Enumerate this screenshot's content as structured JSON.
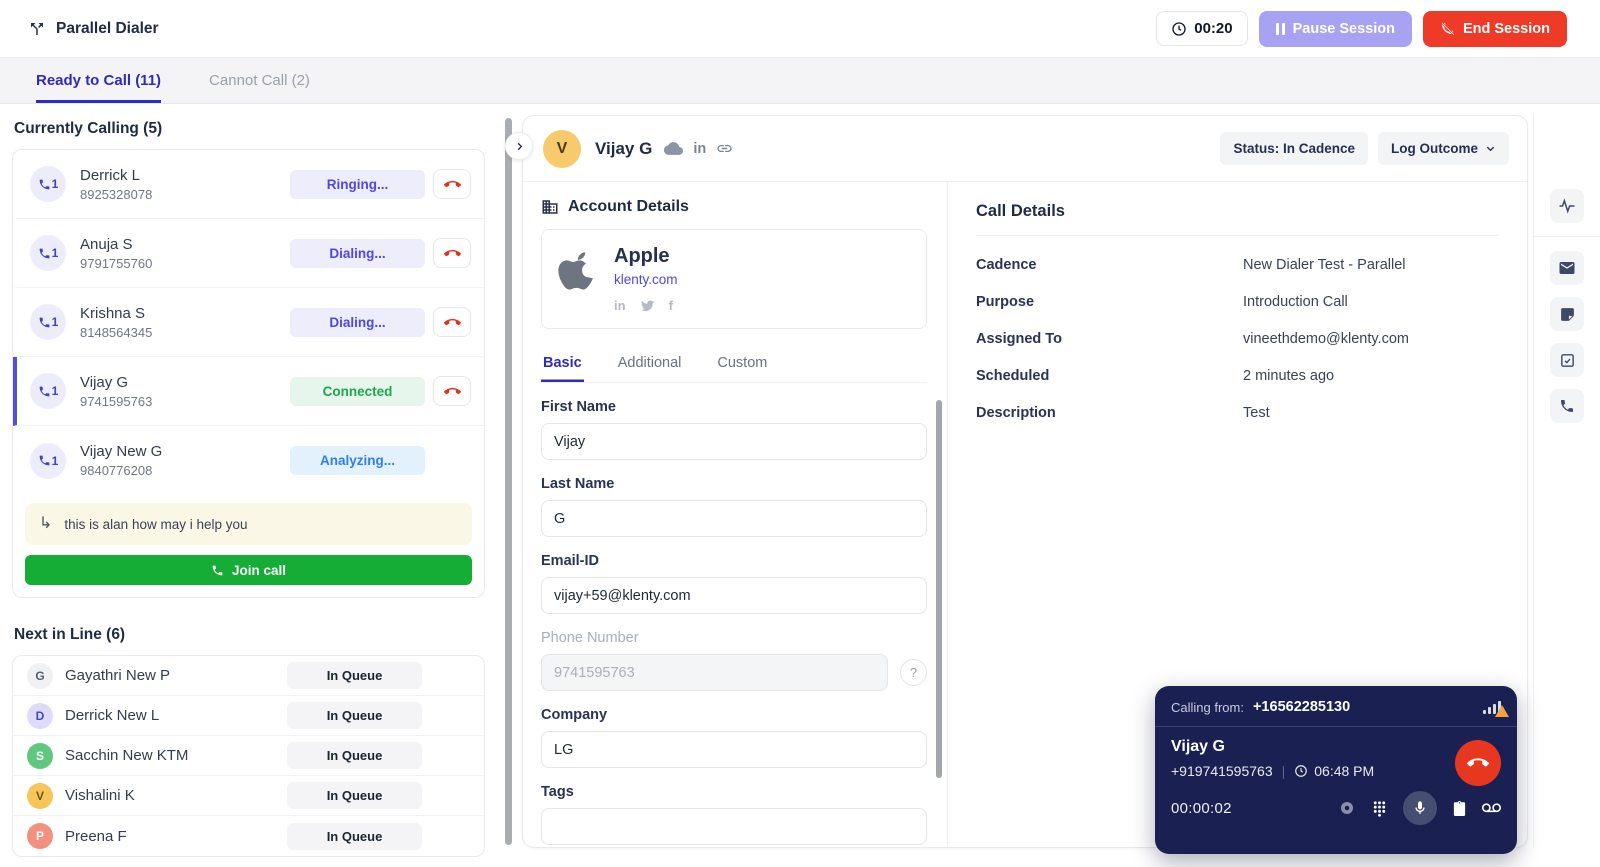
{
  "header": {
    "app_title": "Parallel Dialer",
    "timer": "00:20",
    "pause_button": "Pause Session",
    "end_button": "End Session"
  },
  "tabs": {
    "ready_to_call": "Ready to Call (11)",
    "cannot_call": "Cannot Call (2)"
  },
  "currently_calling": {
    "title": "Currently Calling (5)",
    "calls": [
      {
        "line": "1",
        "name": "Derrick L",
        "phone": "8925328078",
        "status": "Ringing..."
      },
      {
        "line": "1",
        "name": "Anuja S",
        "phone": "9791755760",
        "status": "Dialing..."
      },
      {
        "line": "1",
        "name": "Krishna S",
        "phone": "8148564345",
        "status": "Dialing..."
      },
      {
        "line": "1",
        "name": "Vijay G",
        "phone": "9741595763",
        "status": "Connected"
      },
      {
        "line": "1",
        "name": "Vijay New G",
        "phone": "9840776208",
        "status": "Analyzing..."
      }
    ],
    "transcript": "this is alan how may i help you",
    "join_call": "Join call"
  },
  "next_in_line": {
    "title": "Next in Line (6)",
    "queue_label": "In Queue",
    "items": [
      {
        "initial": "G",
        "name": "Gayathri New P"
      },
      {
        "initial": "D",
        "name": "Derrick New L"
      },
      {
        "initial": "S",
        "name": "Sacchin New KTM"
      },
      {
        "initial": "V",
        "name": "Vishalini K"
      },
      {
        "initial": "P",
        "name": "Preena F"
      }
    ]
  },
  "contact_header": {
    "initial": "V",
    "name": "Vijay G",
    "status_pill": "Status: In Cadence",
    "log_outcome": "Log Outcome"
  },
  "account_details": {
    "title": "Account Details",
    "company_name": "Apple",
    "domain": "klenty.com",
    "tabs": {
      "basic": "Basic",
      "additional": "Additional",
      "custom": "Custom"
    }
  },
  "form": {
    "first_name": {
      "label": "First Name",
      "value": "Vijay"
    },
    "last_name": {
      "label": "Last Name",
      "value": "G"
    },
    "email": {
      "label": "Email-ID",
      "value": "vijay+59@klenty.com"
    },
    "phone": {
      "label": "Phone Number",
      "value": "9741595763"
    },
    "company": {
      "label": "Company",
      "value": "LG"
    },
    "tags": {
      "label": "Tags",
      "value": ""
    }
  },
  "call_details": {
    "title": "Call Details",
    "rows": [
      {
        "label": "Cadence",
        "value": "New Dialer Test - Parallel"
      },
      {
        "label": "Purpose",
        "value": "Introduction Call"
      },
      {
        "label": "Assigned To",
        "value": "vineethdemo@klenty.com"
      },
      {
        "label": "Scheduled",
        "value": "2 minutes ago"
      },
      {
        "label": "Description",
        "value": "Test"
      }
    ]
  },
  "call_widget": {
    "calling_from_label": "Calling from:",
    "calling_from_number": "+16562285130",
    "name": "Vijay G",
    "number": "+919741595763",
    "time": "06:48 PM",
    "duration": "00:00:02"
  },
  "colors": {
    "accent_indigo": "#2f2bbe",
    "connected_green": "#1ea64e",
    "analyzing_blue": "#2f80ed",
    "danger_red": "#ee3a26",
    "join_green": "#15ad36",
    "widget_navy": "#1a2152",
    "warning_amber": "#f2a33c"
  }
}
